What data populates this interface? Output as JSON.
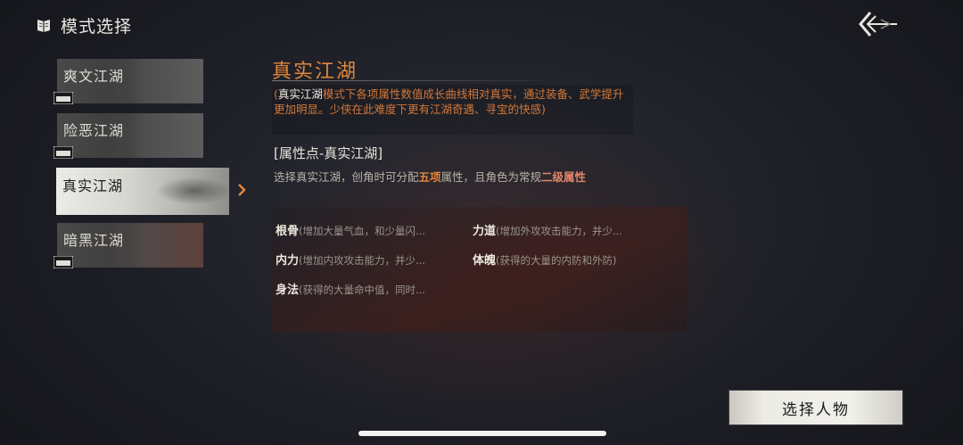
{
  "header": {
    "title": "模式选择",
    "icon": "book-icon",
    "back_icon": "back-arrow-icon"
  },
  "modes": [
    {
      "label": "爽文江湖",
      "locked": true
    },
    {
      "label": "险恶江湖",
      "locked": true
    },
    {
      "label": "真实江湖",
      "locked": false,
      "selected": true
    },
    {
      "label": "暗黑江湖",
      "locked": true
    }
  ],
  "detail": {
    "title": "真实江湖",
    "desc_open": "(",
    "desc_highlight": "真实江湖",
    "desc_rest": "模式下各项属性数值成长曲线相对真实，通过装备、武学提升更加明显。少侠在此难度下更有江湖奇遇、寻宝的快感)",
    "section_title": "[属性点-真实江湖]",
    "section_prefix": "选择真实江湖，创角时可分配",
    "section_count": "五项",
    "section_mid": "属性，且角色为常规",
    "section_level": "二级属性",
    "attributes": [
      {
        "name": "根骨",
        "info": "(增加大量气血，和少量闪..."
      },
      {
        "name": "力道",
        "info": "(增加外攻攻击能力，并少..."
      },
      {
        "name": "内力",
        "info": "(增加内攻攻击能力，并少..."
      },
      {
        "name": "体魄",
        "info": "(获得的大量的内防和外防)"
      },
      {
        "name": "身法",
        "info": "(获得的大量命中值，同时..."
      }
    ]
  },
  "select_button": {
    "label": "选择人物"
  },
  "colors": {
    "accent": "#e2863c",
    "highlight_pink": "#e2866b",
    "background": "#1d1e25"
  }
}
